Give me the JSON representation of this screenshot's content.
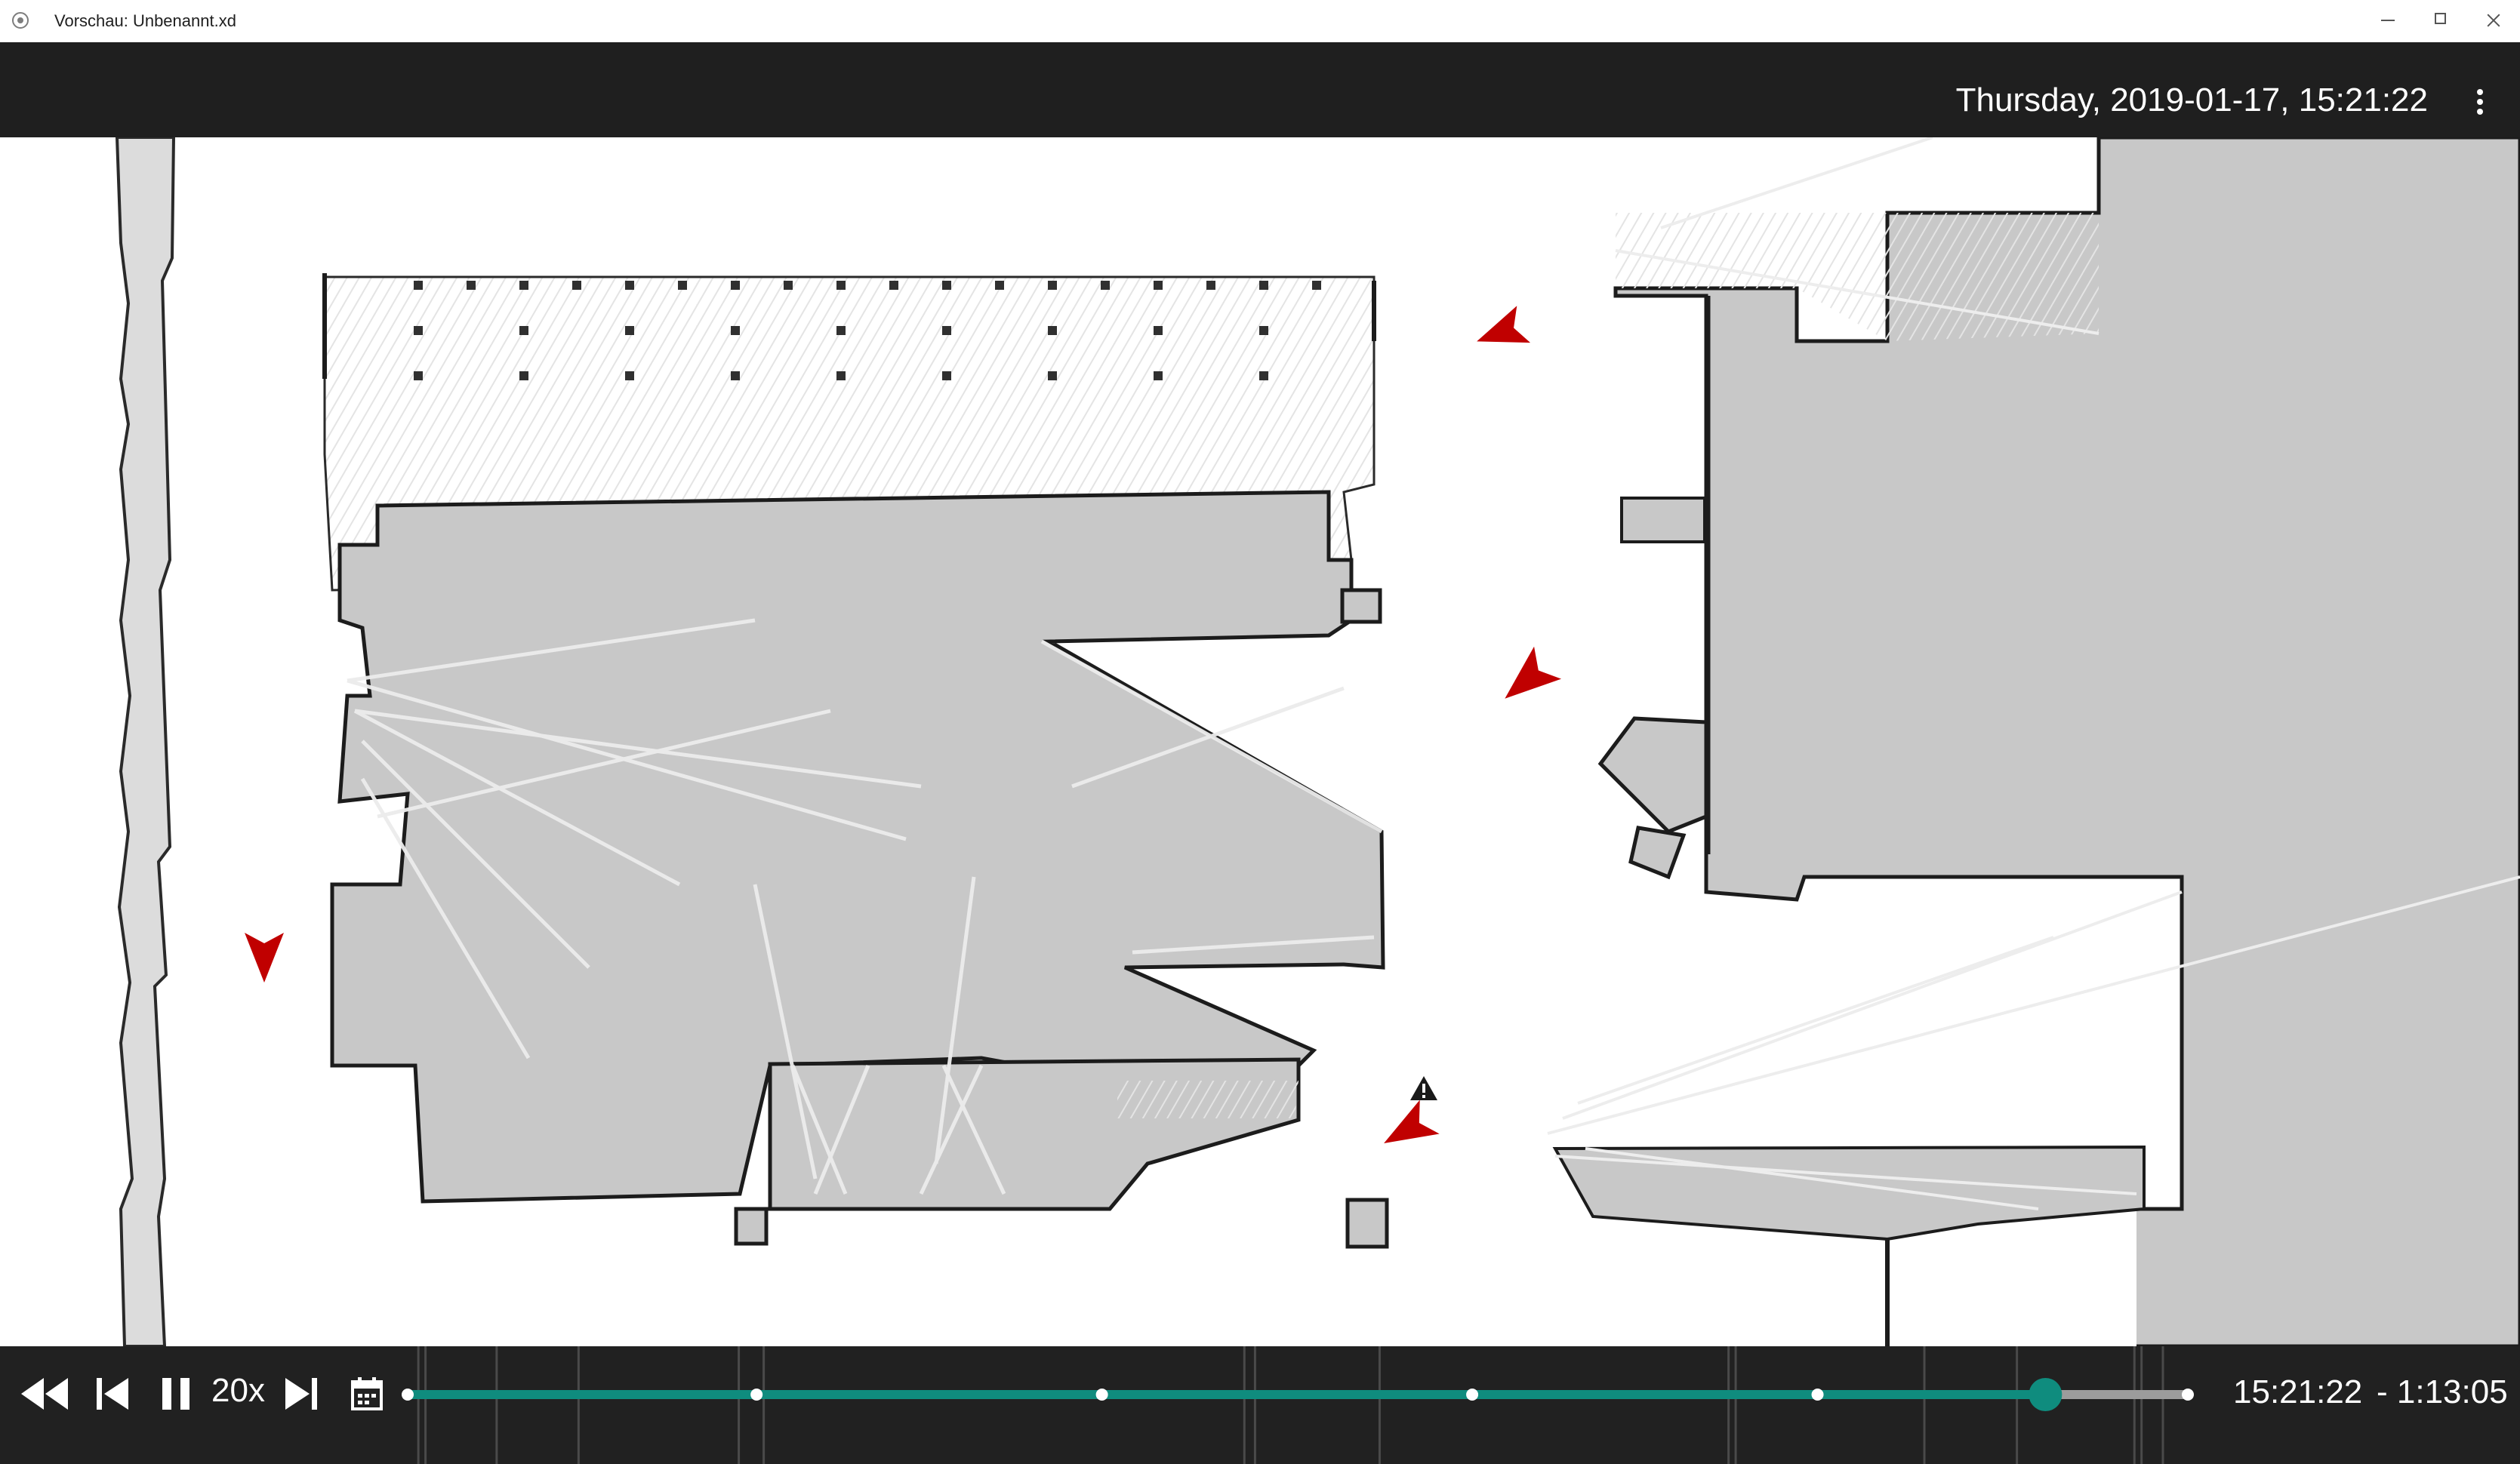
{
  "window": {
    "title": "Vorschau: Unbenannt.xd"
  },
  "header": {
    "datetime": "Thursday, 2019-01-17, 15:21:22"
  },
  "map": {
    "robots": [
      {
        "name": "robot-marker",
        "heading_deg": -110
      },
      {
        "name": "robot-marker",
        "heading_deg": -130
      },
      {
        "name": "robot-marker",
        "heading_deg": 180
      },
      {
        "name": "robot-marker",
        "heading_deg": -120
      }
    ],
    "warning_icon": "warning-triangle-icon",
    "colors": {
      "occupied": "#c8c8c8",
      "free": "#ffffff",
      "wall": "#1c1c1c",
      "robot": "#c00000",
      "accent": "#0f8c7e"
    }
  },
  "playback": {
    "speed": "20x",
    "current_time": "15:21:22",
    "remaining_time": "- 1:13:05",
    "progress": 0.92,
    "markers": [
      0.196,
      0.39,
      0.598,
      0.792
    ],
    "icons": [
      "rewind-icon",
      "skip-previous-icon",
      "pause-icon",
      "skip-next-icon",
      "calendar-icon"
    ]
  }
}
